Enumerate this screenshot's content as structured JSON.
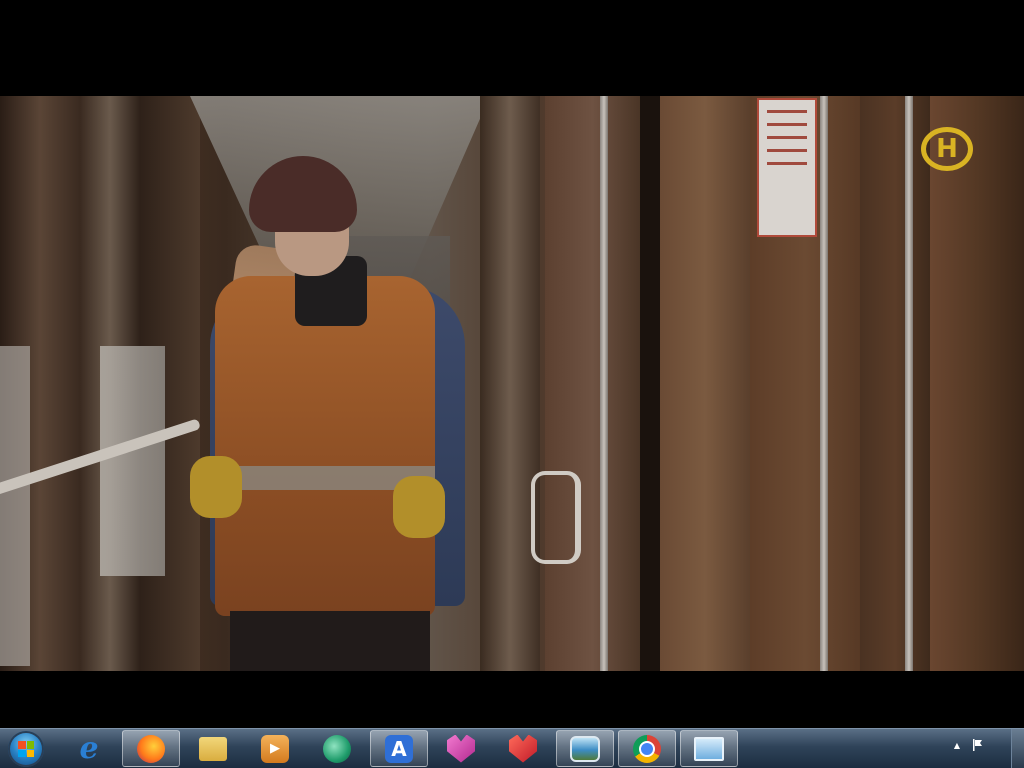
{
  "video": {
    "channel_logo": "Н"
  },
  "taskbar": {
    "start_button": "start-orb",
    "apps": [
      {
        "name": "internet-explorer",
        "icon": "e",
        "active": false,
        "color": "#2a7fd4"
      },
      {
        "name": "firefox",
        "icon": "firefox-icon",
        "active": true,
        "color": "#e8651a"
      },
      {
        "name": "file-explorer",
        "icon": "folder-icon",
        "active": false,
        "color": "#e6c15a"
      },
      {
        "name": "media-player",
        "icon": "play-icon",
        "active": false,
        "color": "#e08a2a"
      },
      {
        "name": "browser-globe",
        "icon": "globe-icon",
        "active": false,
        "color": "#2fae7a"
      },
      {
        "name": "navigator-app",
        "icon": "A",
        "active": true,
        "color": "#2f6fd6"
      },
      {
        "name": "app-pink",
        "icon": "fox-icon",
        "active": false,
        "color": "#d04aa8"
      },
      {
        "name": "app-red",
        "icon": "fox-icon",
        "active": false,
        "color": "#d8323a"
      },
      {
        "name": "image-viewer",
        "icon": "picture-icon",
        "active": true,
        "color": "#4aa0d8"
      },
      {
        "name": "chrome",
        "icon": "chrome-icon",
        "active": true,
        "color": "#4a8ee0"
      },
      {
        "name": "remote-desktop",
        "icon": "monitor-icon",
        "active": true,
        "color": "#7fb6e6"
      }
    ],
    "tray": {
      "show_hidden_icon": "▲",
      "action_center_icon": "flag-icon"
    }
  }
}
